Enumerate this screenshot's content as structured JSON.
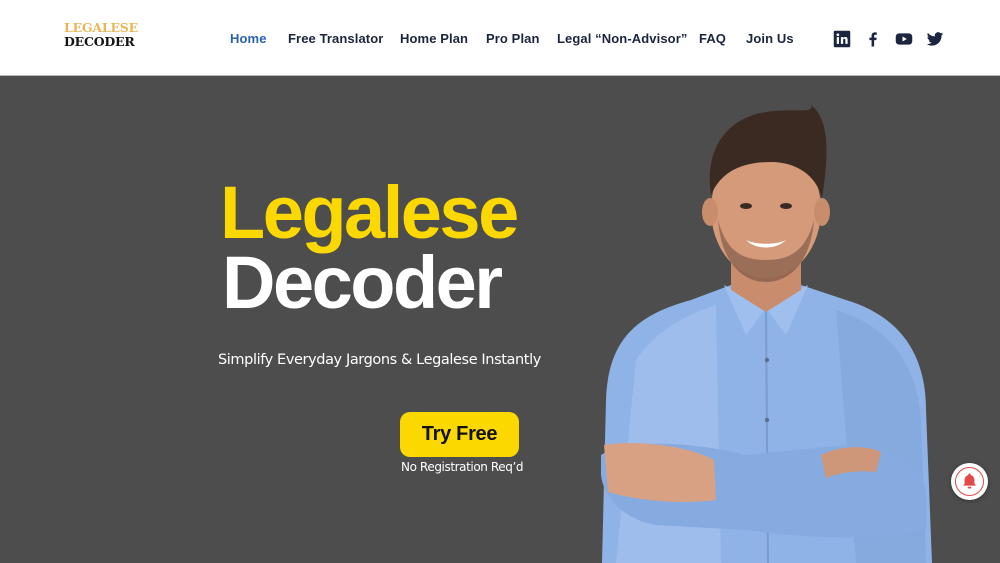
{
  "header": {
    "logo": {
      "line1": "LEGALESE",
      "line2": "DECODER"
    },
    "nav": [
      {
        "label": "Home",
        "active": true
      },
      {
        "label": "Free Translator",
        "active": false
      },
      {
        "label": "Home Plan",
        "active": false
      },
      {
        "label": "Pro Plan",
        "active": false
      },
      {
        "label": "Legal “Non-Advisor”",
        "active": false
      },
      {
        "label": "FAQ",
        "active": false
      },
      {
        "label": "Join Us",
        "active": false
      }
    ],
    "social": [
      {
        "icon": "linkedin-icon"
      },
      {
        "icon": "facebook-icon"
      },
      {
        "icon": "youtube-icon"
      },
      {
        "icon": "twitter-icon"
      }
    ]
  },
  "hero": {
    "title_line1": "Legalese",
    "title_line2": "Decoder",
    "subtitle": "Simplify Everyday Jargons & Legalese Instantly",
    "cta_label": "Try Free",
    "cta_note": "No Registration Req’d",
    "image_alt": "Smiling man in blue shirt with arms crossed"
  },
  "notification": {
    "icon": "bell-icon"
  },
  "colors": {
    "accent_yellow": "#fbd900",
    "nav_active": "#2a62b0",
    "nav_text": "#1c2540",
    "hero_bg": "#4d4d4d",
    "logo_gold": "#e9b65a",
    "bell_red": "#e24a4a"
  }
}
